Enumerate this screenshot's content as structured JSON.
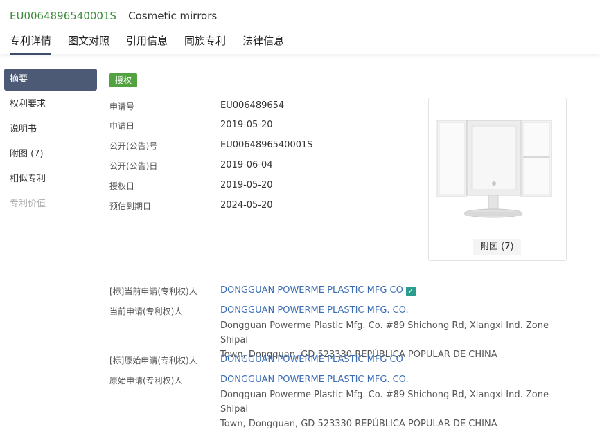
{
  "header": {
    "patent_number": "EU0064896540001S",
    "patent_title": "Cosmetic mirrors",
    "tabs": [
      "专利详情",
      "图文对照",
      "引用信息",
      "同族专利",
      "法律信息"
    ]
  },
  "sidebar": {
    "items": [
      "摘要",
      "权利要求",
      "说明书",
      "附图 (7)",
      "相似专利",
      "专利价值"
    ]
  },
  "status_badge": "授权",
  "fields": [
    {
      "label": "申请号",
      "value": "EU006489654"
    },
    {
      "label": "申请日",
      "value": "2019-05-20"
    },
    {
      "label": "公开(公告)号",
      "value": "EU0064896540001S"
    },
    {
      "label": "公开(公告)日",
      "value": "2019-06-04"
    },
    {
      "label": "授权日",
      "value": "2019-05-20"
    },
    {
      "label": "预估到期日",
      "value": "2024-05-20"
    }
  ],
  "image_card": {
    "button_label": "附图 (7)"
  },
  "applicants": [
    {
      "label": "[标]当前申请(专利权)人",
      "name": "DONGGUAN POWERME PLASTIC MFG CO"
    },
    {
      "label": "当前申请(专利权)人",
      "name": "DONGGUAN POWERME PLASTIC MFG. CO.",
      "address_line1": "Dongguan Powerme Plastic Mfg. Co. #89 Shichong Rd, Xiangxi Ind. Zone Shipai",
      "address_line2": "Town, Dongguan, GD 523330 REPÚBLICA POPULAR DE CHINA"
    },
    {
      "label": "[标]原始申请(专利权)人",
      "name": "DONGGUAN POWERME PLASTIC MFG CO"
    },
    {
      "label": "原始申请(专利权)人",
      "name": "DONGGUAN POWERME PLASTIC MFG. CO.",
      "address_line1": "Dongguan Powerme Plastic Mfg. Co. #89 Shichong Rd, Xiangxi Ind. Zone Shipai",
      "address_line2": "Town, Dongguan, GD 523330 REPÚBLICA POPULAR DE CHINA"
    }
  ],
  "colors": {
    "accent_green": "#3c8c3c",
    "badge_green": "#52a33f",
    "link_blue": "#3a6cb4",
    "nav_active": "#4c5a76"
  },
  "icons": {
    "verified": "check-square-icon"
  }
}
